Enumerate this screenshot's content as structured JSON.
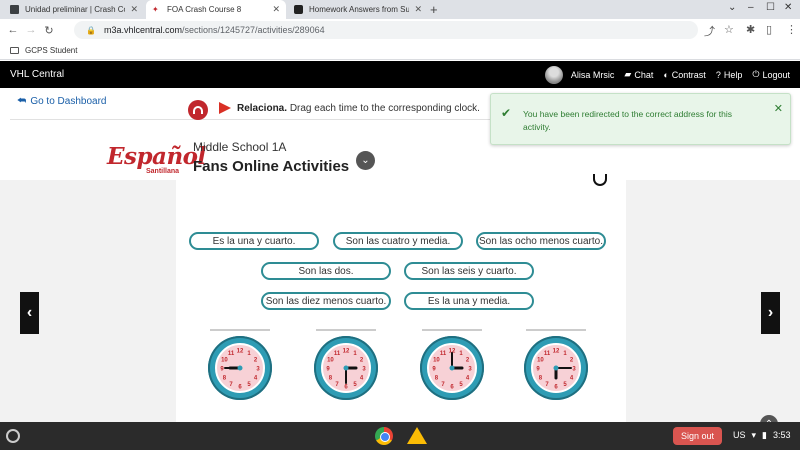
{
  "browser": {
    "tabs": [
      {
        "title": "Unidad preliminar | Crash Course",
        "active": false
      },
      {
        "title": "FOA Crash Course 8",
        "active": true
      },
      {
        "title": "Homework Answers from Subject",
        "active": false
      }
    ],
    "url_host": "m3a.vhlcentral.com",
    "url_path": "/sections/1245727/activities/289064",
    "bookmark": "GCPS Student"
  },
  "vhl": {
    "brand": "VHL Central",
    "user": "Alisa Mrsic",
    "chat": "Chat",
    "contrast": "Contrast",
    "help": "Help",
    "logout": "Logout"
  },
  "page": {
    "back_link": "Go to Dashboard",
    "logo_text": "Español",
    "logo_sub": "Santillana",
    "course": "Middle School 1A",
    "title": "Fans Online Activities",
    "toast": "You have been redirected to the correct address for this activity.",
    "instruction_bold": "Relaciona.",
    "instruction_text": "Drag each time to the corresponding clock."
  },
  "options": [
    "Es la una y cuarto.",
    "Son las cuatro y media.",
    "Son las ocho menos cuarto.",
    "Son las dos.",
    "Son las seis y cuarto.",
    "Son las diez menos cuarto.",
    "Es la una y media."
  ],
  "clocks": [
    {
      "name": "clock-1",
      "hour_angle": 270,
      "minute_angle": 270
    },
    {
      "name": "clock-2",
      "hour_angle": 90,
      "minute_angle": 180
    },
    {
      "name": "clock-3",
      "hour_angle": 90,
      "minute_angle": 0
    },
    {
      "name": "clock-4",
      "hour_angle": 180,
      "minute_angle": 90
    }
  ],
  "shelf": {
    "signout": "Sign out",
    "locale": "US",
    "time": "3:53"
  },
  "colors": {
    "accent_red": "#c1272d",
    "teal": "#2e8c94",
    "toast_green": "#2e7d32"
  }
}
